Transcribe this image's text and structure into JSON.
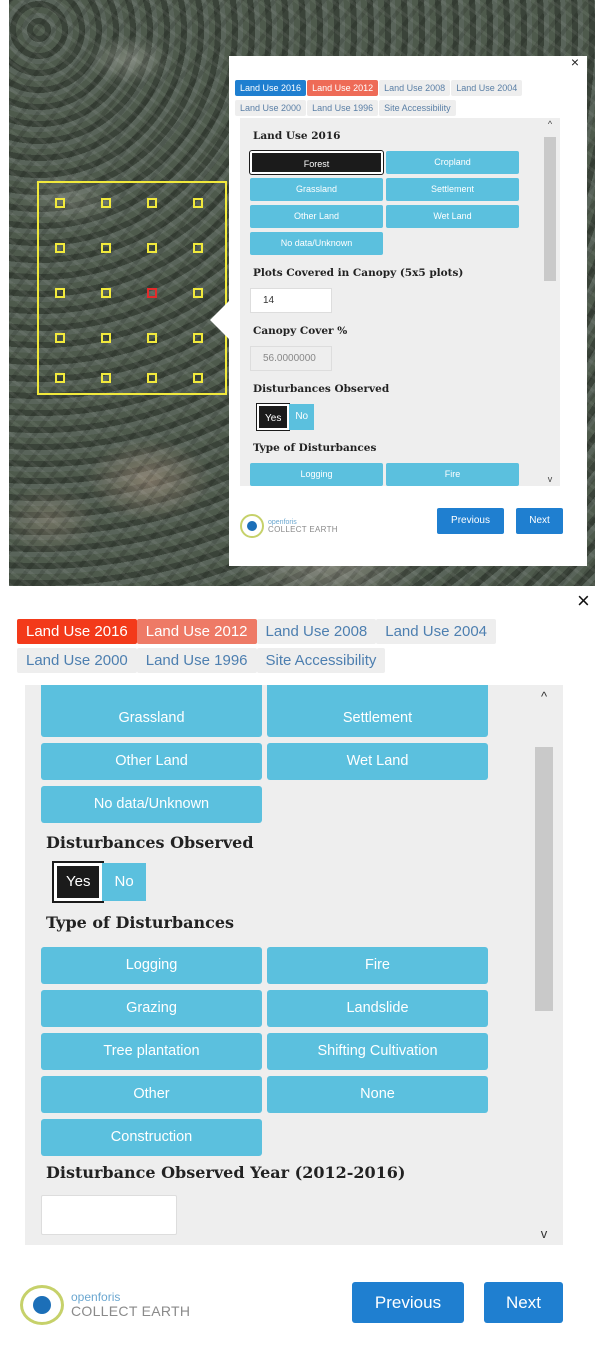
{
  "top": {
    "close_glyph": "×",
    "tabs": [
      {
        "label": "Land Use 2016",
        "state": "active"
      },
      {
        "label": "Land Use 2012",
        "state": "other"
      },
      {
        "label": "Land Use 2008",
        "state": ""
      },
      {
        "label": "Land Use 2004",
        "state": ""
      },
      {
        "label": "Land Use 2000",
        "state": ""
      },
      {
        "label": "Land Use 1996",
        "state": ""
      },
      {
        "label": "Site Accessibility",
        "state": ""
      }
    ],
    "land_use_label": "Land Use 2016",
    "land_use_options": [
      "Forest",
      "Cropland",
      "Grassland",
      "Settlement",
      "Other Land",
      "Wet Land",
      "No data/Unknown"
    ],
    "land_use_selected": "Forest",
    "plots_label": "Plots Covered in Canopy (5x5 plots)",
    "plots_value": "14",
    "canopy_label": "Canopy Cover %",
    "canopy_value": "56.0000000",
    "disturbances_label": "Disturbances Observed",
    "yes": "Yes",
    "no": "No",
    "type_label": "Type of Disturbances",
    "type_options_visible": [
      "Logging",
      "Fire"
    ],
    "scroll_up": "^",
    "scroll_down": "v",
    "logo_top": "openforis",
    "logo_bottom": "COLLECT EARTH",
    "previous": "Previous",
    "next": "Next"
  },
  "bottom": {
    "close_glyph": "×",
    "tabs": [
      {
        "label": "Land Use 2016",
        "state": "active"
      },
      {
        "label": "Land Use 2012",
        "state": "other"
      },
      {
        "label": "Land Use 2008",
        "state": ""
      },
      {
        "label": "Land Use 2004",
        "state": ""
      },
      {
        "label": "Land Use 2000",
        "state": ""
      },
      {
        "label": "Land Use 1996",
        "state": ""
      },
      {
        "label": "Site Accessibility",
        "state": ""
      }
    ],
    "land_use_options": [
      "Grassland",
      "Settlement",
      "Other Land",
      "Wet Land",
      "No data/Unknown"
    ],
    "disturbances_label": "Disturbances Observed",
    "yes": "Yes",
    "no": "No",
    "type_label": "Type of Disturbances",
    "type_options": [
      "Logging",
      "Fire",
      "Grazing",
      "Landslide",
      "Tree plantation",
      "Shifting Cultivation",
      "Other",
      "None",
      "Construction"
    ],
    "year_label": "Disturbance Observed Year (2012-2016)",
    "year_value": "",
    "scroll_up": "^",
    "scroll_down": "v",
    "logo_top": "openforis",
    "logo_bottom": "COLLECT EARTH",
    "previous": "Previous",
    "next": "Next"
  },
  "colors": {
    "info_button": "#5bc0de",
    "primary_button": "#1f7fd0",
    "active_tab": "#f33a1a",
    "secondary_tab": "#ee7a66"
  },
  "icons": {
    "close": "close-icon",
    "scroll_up": "scroll-up-icon",
    "scroll_down": "scroll-down-icon",
    "logo": "openforis-logo-icon"
  }
}
